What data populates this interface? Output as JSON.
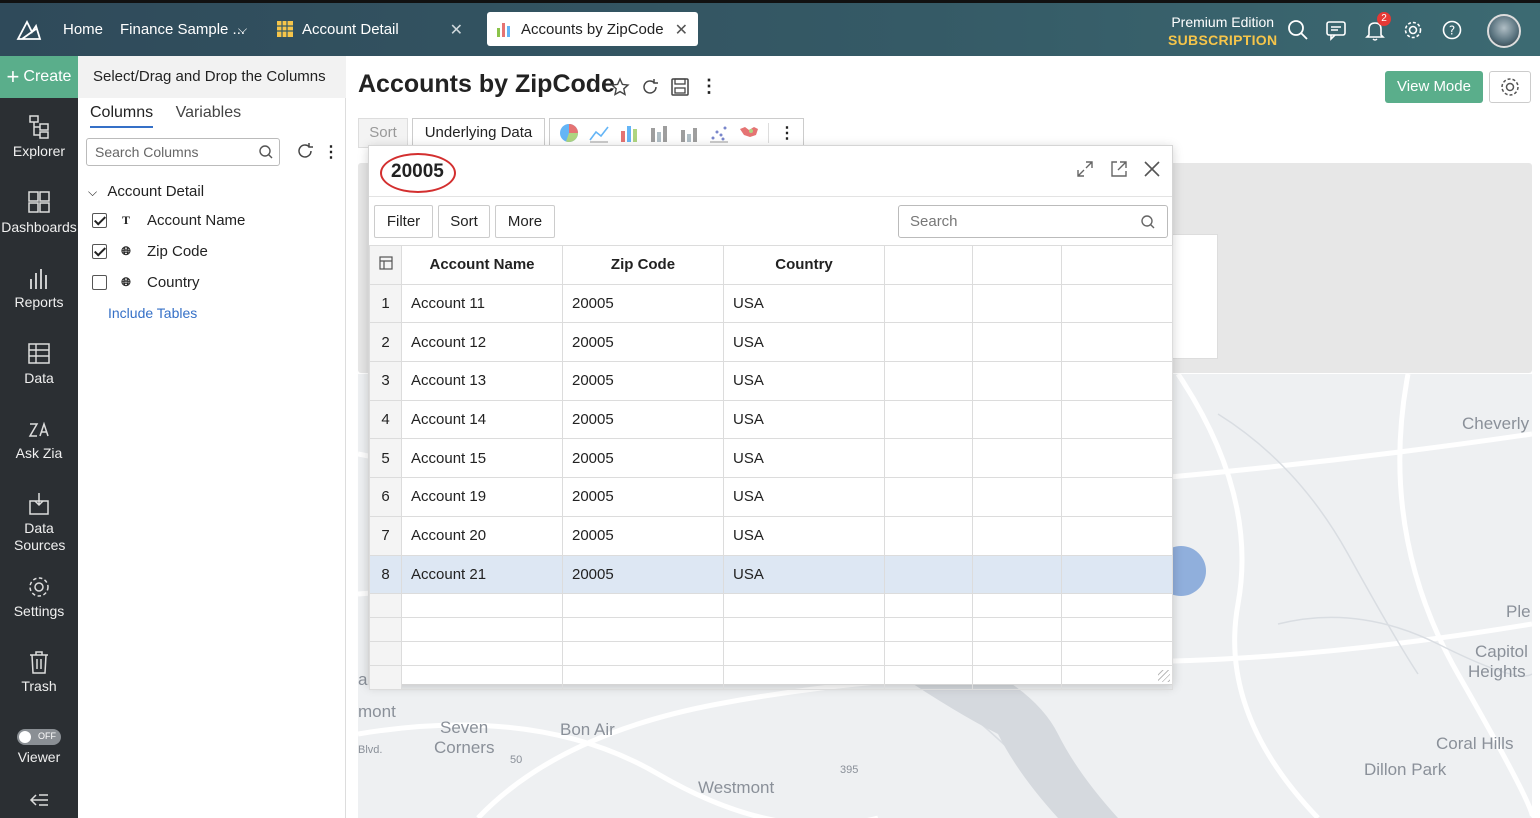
{
  "topbar": {
    "home": "Home",
    "workspace": "Finance Sample ...",
    "tabs": [
      {
        "label": "Account Detail",
        "active": false
      },
      {
        "label": "Accounts by ZipCode",
        "active": true
      }
    ],
    "edition": "Premium Edition",
    "subscription": "SUBSCRIPTION",
    "notification_count": "2"
  },
  "sidebar": {
    "create": "Create",
    "items": [
      {
        "label": "Explorer",
        "icon": "explorer-icon"
      },
      {
        "label": "Dashboards",
        "icon": "dashboards-icon"
      },
      {
        "label": "Reports",
        "icon": "reports-icon"
      },
      {
        "label": "Data",
        "icon": "data-icon"
      },
      {
        "label": "Ask Zia",
        "icon": "ask-zia-icon"
      },
      {
        "label": "Data Sources",
        "icon": "data-sources-icon"
      },
      {
        "label": "Settings",
        "icon": "settings-icon"
      },
      {
        "label": "Trash",
        "icon": "trash-icon"
      },
      {
        "label": "Viewer",
        "icon": "toggle-icon"
      }
    ],
    "viewer_toggle": "OFF"
  },
  "columns_panel": {
    "header": "Select/Drag and Drop the Columns",
    "tabs": [
      "Columns",
      "Variables"
    ],
    "search_placeholder": "Search Columns",
    "group": "Account Detail",
    "columns": [
      {
        "label": "Account Name",
        "checked": true,
        "type": "text"
      },
      {
        "label": "Zip Code",
        "checked": true,
        "type": "geo"
      },
      {
        "label": "Country",
        "checked": false,
        "type": "geo"
      }
    ],
    "include_tables": "Include Tables"
  },
  "report": {
    "title": "Accounts by ZipCode",
    "view_mode": "View Mode",
    "toolbar": {
      "sort": "Sort",
      "underlying": "Underlying Data"
    }
  },
  "map_labels": [
    "Cheverly",
    "Seven",
    "Corners",
    "Bon Air",
    "Westmont",
    "Capitol",
    "Heights",
    "Coral Hills",
    "Dillon Park",
    "mont",
    "Blvd.",
    "Ple",
    "al",
    "50",
    "395"
  ],
  "modal": {
    "title": "20005",
    "buttons": [
      "Filter",
      "Sort",
      "More"
    ],
    "search_placeholder": "Search",
    "columns": [
      "Account Name",
      "Zip Code",
      "Country"
    ],
    "rows": [
      {
        "n": "1",
        "account": "Account 11",
        "zip": "20005",
        "country": "USA"
      },
      {
        "n": "2",
        "account": "Account 12",
        "zip": "20005",
        "country": "USA"
      },
      {
        "n": "3",
        "account": "Account 13",
        "zip": "20005",
        "country": "USA"
      },
      {
        "n": "4",
        "account": "Account 14",
        "zip": "20005",
        "country": "USA"
      },
      {
        "n": "5",
        "account": "Account 15",
        "zip": "20005",
        "country": "USA"
      },
      {
        "n": "6",
        "account": "Account 19",
        "zip": "20005",
        "country": "USA"
      },
      {
        "n": "7",
        "account": "Account 20",
        "zip": "20005",
        "country": "USA"
      },
      {
        "n": "8",
        "account": "Account 21",
        "zip": "20005",
        "country": "USA"
      }
    ],
    "selected_row": "8"
  },
  "colors": {
    "accent_green": "#5aae8b",
    "topbar": "#355a66",
    "sidebar": "#2b2f33",
    "link_blue": "#3570c7",
    "highlight_circle": "#d32f2f"
  }
}
